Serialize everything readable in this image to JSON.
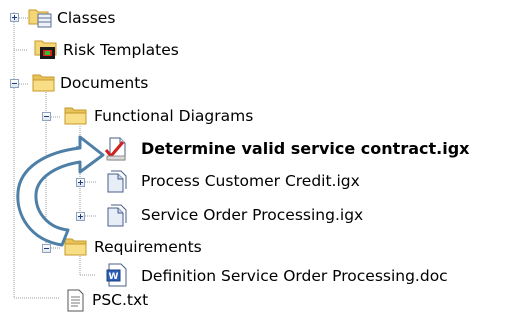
{
  "tree": {
    "items": [
      {
        "label": "Classes",
        "icon": "folder-class-icon",
        "expander": "expand"
      },
      {
        "label": "Risk Templates",
        "icon": "risk-template-icon",
        "expander": "none"
      },
      {
        "label": "Documents",
        "icon": "folder-open-icon",
        "expander": "collapse"
      },
      {
        "label": "Functional Diagrams",
        "icon": "folder-open-icon",
        "expander": "collapse"
      },
      {
        "label": "Determine valid service contract.igx",
        "icon": "diagram-checked-icon",
        "expander": "expand",
        "selected": true
      },
      {
        "label": "Process Customer Credit.igx",
        "icon": "diagram-icon",
        "expander": "expand"
      },
      {
        "label": "Service Order Processing.igx",
        "icon": "diagram-icon",
        "expander": "expand"
      },
      {
        "label": "Requirements",
        "icon": "folder-open-icon",
        "expander": "collapse"
      },
      {
        "label": "Definition Service Order Processing.doc",
        "icon": "word-document-icon",
        "expander": "none"
      },
      {
        "label": "PSC.txt",
        "icon": "text-file-icon",
        "expander": "none"
      }
    ]
  },
  "annotation": {
    "icon": "curved-arrow-icon",
    "color": "#4d7fa7"
  },
  "colors": {
    "folder": "#f4d675",
    "check": "#d02020",
    "arrow_fill": "#ffffff"
  }
}
